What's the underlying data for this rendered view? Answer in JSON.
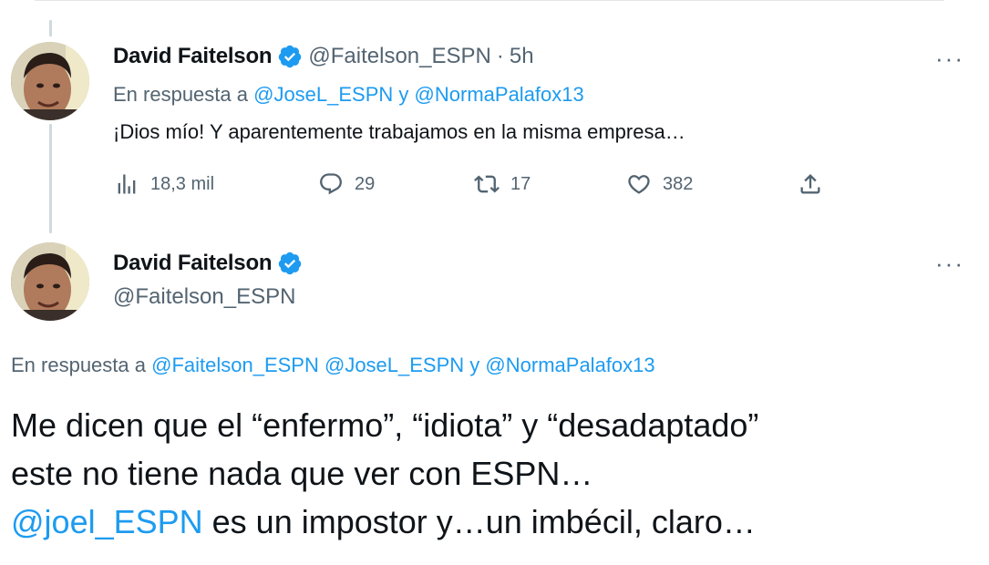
{
  "tweet1": {
    "name": "David Faitelson",
    "handle": "@Faitelson_ESPN",
    "sep": "·",
    "time": "5h",
    "reply_prefix": "En respuesta a",
    "reply_mention_1": "@JoseL_ESPN",
    "reply_joiner": "y",
    "reply_mention_2": "@NormaPalafox13",
    "text": "¡Dios mío! Y aparentemente trabajamos en la misma empresa…",
    "views": "18,3 mil",
    "replies": "29",
    "retweets": "17",
    "likes": "382",
    "more": "···"
  },
  "tweet2": {
    "name": "David Faitelson",
    "handle": "@Faitelson_ESPN",
    "reply_prefix": "En respuesta a",
    "reply_mention_1": "@Faitelson_ESPN",
    "reply_mention_2": "@JoseL_ESPN",
    "reply_joiner": "y",
    "reply_mention_3": "@NormaPalafox13",
    "line1": "Me dicen que el “enfermo”, “idiota” y “desadaptado”",
    "line2": "este no tiene nada que ver con ESPN…",
    "line3_mention": "@joel_ESPN",
    "line3_rest": " es un impostor y…un imbécil, claro…",
    "more": "···"
  },
  "colors": {
    "accent": "#1d9bf0",
    "secondary_text": "#536471",
    "primary_text": "#0f1419",
    "thread_line": "#cfd9de"
  },
  "icons": [
    "views-icon",
    "reply-icon",
    "retweet-icon",
    "like-icon",
    "share-icon",
    "verified-badge-icon",
    "more-icon"
  ]
}
